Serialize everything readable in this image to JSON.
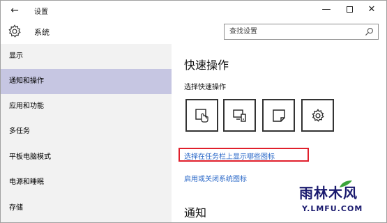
{
  "window": {
    "back_glyph": "←",
    "title": "设置",
    "minimize_glyph": "—",
    "close_glyph": "✕"
  },
  "header": {
    "icon": "gear-icon",
    "title": "系统",
    "search_placeholder": "查找设置",
    "search_icon": "search-icon"
  },
  "sidebar": {
    "items": [
      {
        "label": "显示"
      },
      {
        "label": "通知和操作",
        "selected": true
      },
      {
        "label": "应用和功能"
      },
      {
        "label": "多任务"
      },
      {
        "label": "平板电脑模式"
      },
      {
        "label": "电源和睡眠"
      },
      {
        "label": "存储"
      }
    ]
  },
  "content": {
    "quick_actions_heading": "快速操作",
    "quick_actions_subtitle": "选择快速操作",
    "tiles": [
      {
        "icon": "tablet-mode-icon"
      },
      {
        "icon": "connect-display-icon"
      },
      {
        "icon": "note-icon"
      },
      {
        "icon": "settings-gear-icon"
      }
    ],
    "link_taskbar_icons": "选择在任务栏上显示哪些图标",
    "link_system_icons": "启用或关闭系统图标",
    "notifications_heading": "通知"
  },
  "colors": {
    "selected_bg": "#c6c6e2",
    "link": "#2a68c8",
    "highlight": "#e0202c"
  },
  "watermark": {
    "main": "雨林木风",
    "sub": "Y.LMFU.COM"
  }
}
